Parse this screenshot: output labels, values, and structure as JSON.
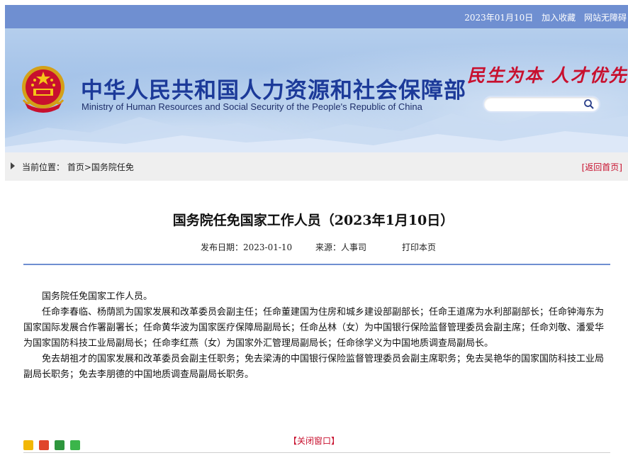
{
  "topbar": {
    "date": "2023年01月10日",
    "favorite": "加入收藏",
    "accessible": "网站无障碍"
  },
  "header": {
    "title_cn": "中华人民共和国人力资源和社会保障部",
    "title_en": "Ministry of Human Resources and Social Security of the People's Republic of China",
    "slogan": "民生为本 人才优先",
    "search_placeholder": ""
  },
  "breadcrumb": {
    "label": "当前位置：",
    "path": "首页>国务院任免",
    "back": "[返回首页]"
  },
  "article": {
    "title": "国务院任免国家工作人员（2023年1月10日）",
    "meta": {
      "date_label": "发布日期：2023-01-10",
      "source_label": "来源：人事司",
      "print": "打印本页"
    },
    "paragraphs": [
      "国务院任免国家工作人员。",
      "任命李春临、杨荫凯为国家发展和改革委员会副主任；任命董建国为住房和城乡建设部副部长；任命王道席为水利部副部长；任命钟海东为国家国际发展合作署副署长；任命黄华波为国家医疗保障局副局长；任命丛林（女）为中国银行保险监督管理委员会副主席；任命刘敬、潘爱华为国家国防科技工业局副局长；任命李红燕（女）为国家外汇管理局副局长；任命徐学义为中国地质调查局副局长。",
      "免去胡祖才的国家发展和改革委员会副主任职务；免去梁涛的中国银行保险监督管理委员会副主席职务；免去吴艳华的国家国防科技工业局副局长职务；免去李朋德的中国地质调查局副局长职务。"
    ],
    "close": "【关闭窗口】"
  },
  "colors": {
    "topbar": "#6f8fd1",
    "title_blue": "#1c3a99",
    "accent_red": "#c8102e"
  }
}
